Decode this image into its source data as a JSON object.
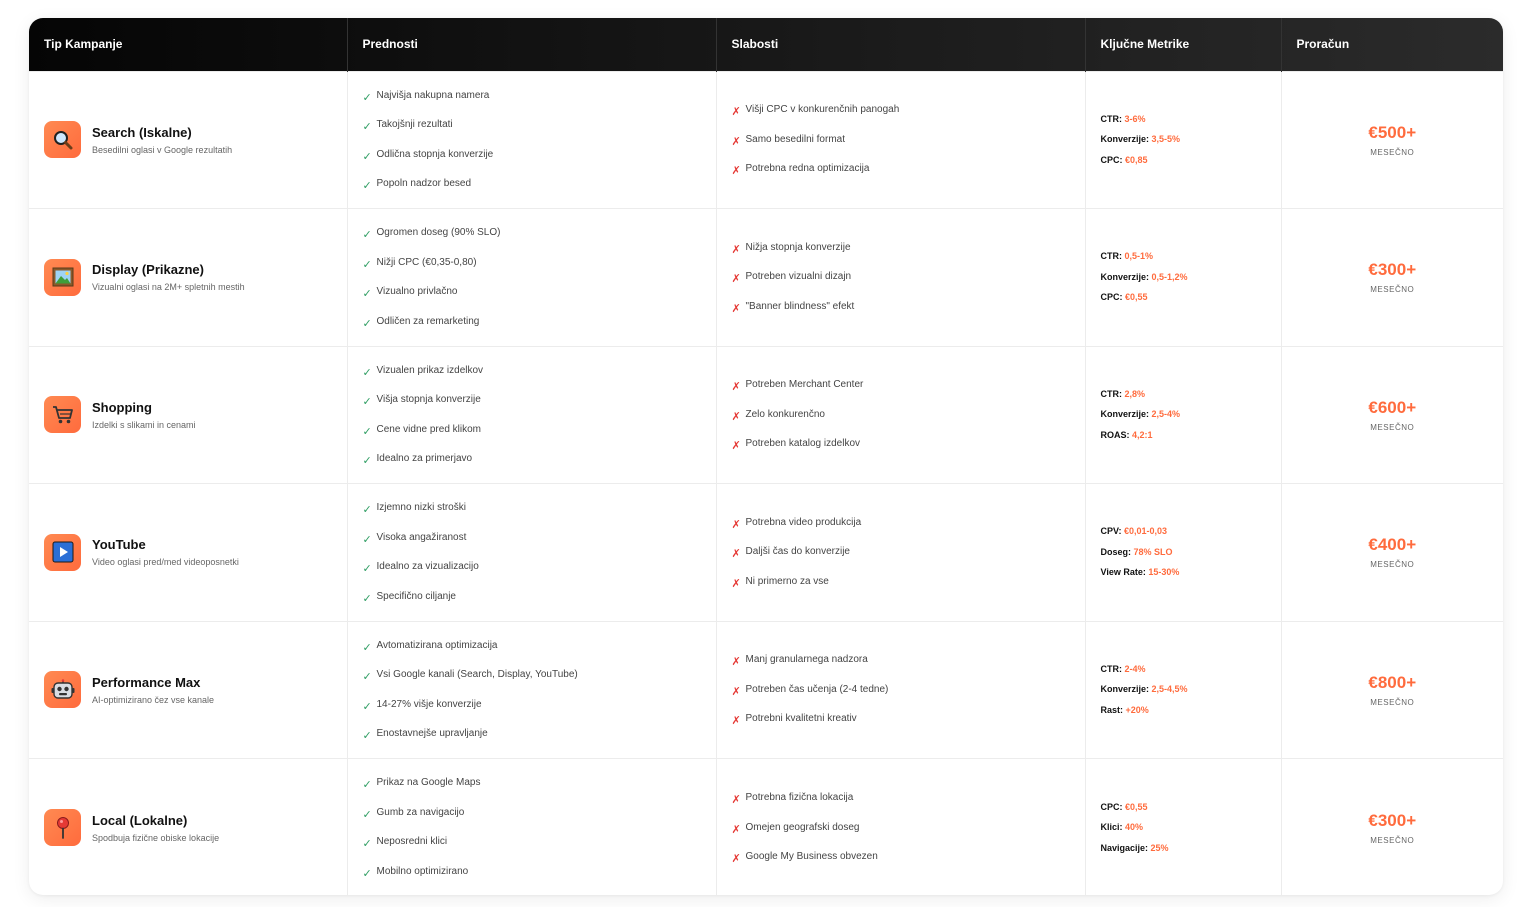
{
  "headers": [
    "Tip Kampanje",
    "Prednosti",
    "Slabosti",
    "Ključne Metrike",
    "Proračun"
  ],
  "campaigns": [
    {
      "name": "Search (Iskalne)",
      "desc": "Besedilni oglasi v Google rezultatih",
      "icon": "magnifier-icon",
      "pros": [
        "Najvišja nakupna namera",
        "Takojšnji rezultati",
        "Odlična stopnja konverzije",
        "Popoln nadzor besed"
      ],
      "cons": [
        "Višji CPC v konkurenčnih panogah",
        "Samo besedilni format",
        "Potrebna redna optimizacija"
      ],
      "metrics": [
        {
          "label": "CTR:",
          "value": "3-6%"
        },
        {
          "label": "Konverzije:",
          "value": "3,5-5%"
        },
        {
          "label": "CPC:",
          "value": "€0,85"
        }
      ],
      "budget": "€500+",
      "period": "MESEČNO"
    },
    {
      "name": "Display (Prikazne)",
      "desc": "Vizualni oglasi na 2M+ spletnih mestih",
      "icon": "picture-frame-icon",
      "pros": [
        "Ogromen doseg (90% SLO)",
        "Nižji CPC (€0,35-0,80)",
        "Vizualno privlačno",
        "Odličen za remarketing"
      ],
      "cons": [
        "Nižja stopnja konverzije",
        "Potreben vizualni dizajn",
        "\"Banner blindness\" efekt"
      ],
      "metrics": [
        {
          "label": "CTR:",
          "value": "0,5-1%"
        },
        {
          "label": "Konverzije:",
          "value": "0,5-1,2%"
        },
        {
          "label": "CPC:",
          "value": "€0,55"
        }
      ],
      "budget": "€300+",
      "period": "MESEČNO"
    },
    {
      "name": "Shopping",
      "desc": "Izdelki s slikami in cenami",
      "icon": "shopping-cart-icon",
      "pros": [
        "Vizualen prikaz izdelkov",
        "Višja stopnja konverzije",
        "Cene vidne pred klikom",
        "Idealno za primerjavo"
      ],
      "cons": [
        "Potreben Merchant Center",
        "Zelo konkurenčno",
        "Potreben katalog izdelkov"
      ],
      "metrics": [
        {
          "label": "CTR:",
          "value": "2,8%"
        },
        {
          "label": "Konverzije:",
          "value": "2,5-4%"
        },
        {
          "label": "ROAS:",
          "value": "4,2:1"
        }
      ],
      "budget": "€600+",
      "period": "MESEČNO"
    },
    {
      "name": "YouTube",
      "desc": "Video oglasi pred/med videoposnetki",
      "icon": "play-button-icon",
      "pros": [
        "Izjemno nizki stroški",
        "Visoka angažiranost",
        "Idealno za vizualizacijo",
        "Specifično ciljanje"
      ],
      "cons": [
        "Potrebna video produkcija",
        "Daljši čas do konverzije",
        "Ni primerno za vse"
      ],
      "metrics": [
        {
          "label": "CPV:",
          "value": "€0,01-0,03"
        },
        {
          "label": "Doseg:",
          "value": "78% SLO"
        },
        {
          "label": "View Rate:",
          "value": "15-30%"
        }
      ],
      "budget": "€400+",
      "period": "MESEČNO"
    },
    {
      "name": "Performance Max",
      "desc": "AI-optimizirano čez vse kanale",
      "icon": "robot-icon",
      "pros": [
        "Avtomatizirana optimizacija",
        "Vsi Google kanali (Search, Display, YouTube)",
        "14-27% višje konverzije",
        "Enostavnejše upravljanje"
      ],
      "cons": [
        "Manj granularnega nadzora",
        "Potreben čas učenja (2-4 tedne)",
        "Potrebni kvalitetni kreativ"
      ],
      "metrics": [
        {
          "label": "CTR:",
          "value": "2-4%"
        },
        {
          "label": "Konverzije:",
          "value": "2,5-4,5%"
        },
        {
          "label": "Rast:",
          "value": "+20%"
        }
      ],
      "budget": "€800+",
      "period": "MESEČNO"
    },
    {
      "name": "Local (Lokalne)",
      "desc": "Spodbuja fizične obiske lokacije",
      "icon": "map-pin-icon",
      "pros": [
        "Prikaz na Google Maps",
        "Gumb za navigacijo",
        "Neposredni klici",
        "Mobilno optimizirano"
      ],
      "cons": [
        "Potrebna fizična lokacija",
        "Omejen geografski doseg",
        "Google My Business obvezen"
      ],
      "metrics": [
        {
          "label": "CPC:",
          "value": "€0,55"
        },
        {
          "label": "Klici:",
          "value": "40%"
        },
        {
          "label": "Navigacije:",
          "value": "25%"
        }
      ],
      "budget": "€300+",
      "period": "MESEČNO"
    }
  ]
}
